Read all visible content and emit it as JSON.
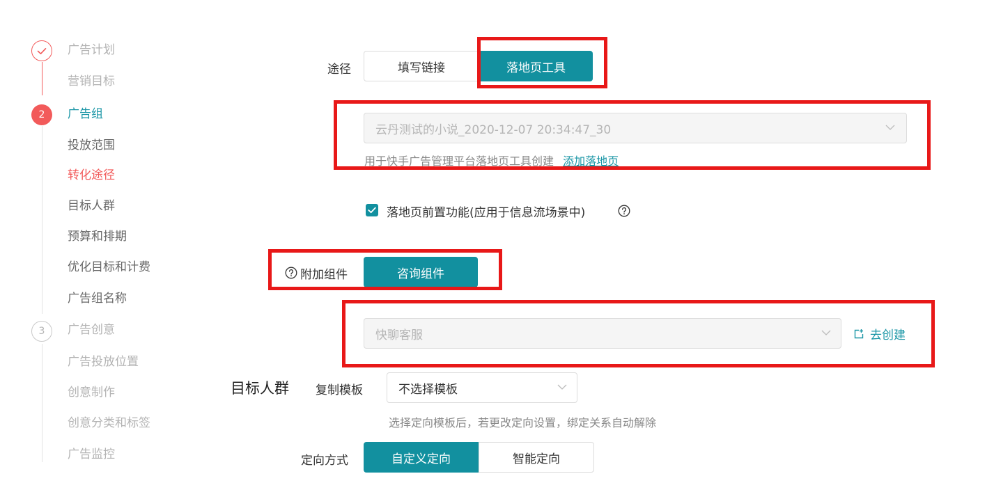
{
  "colors": {
    "accent": "#12909f",
    "link": "#1a96a6",
    "step_active": "#f25a5a",
    "annotation_red": "#e81818"
  },
  "steps": [
    {
      "number": "",
      "label": "广告计划",
      "state": "done",
      "icon": "check-icon",
      "items": [
        {
          "label": "营销目标"
        }
      ]
    },
    {
      "number": "2",
      "label": "广告组",
      "state": "current",
      "items": [
        {
          "label": "投放范围"
        },
        {
          "label": "转化途径",
          "current": true
        },
        {
          "label": "目标人群"
        },
        {
          "label": "预算和排期"
        },
        {
          "label": "优化目标和计费"
        },
        {
          "label": "广告组名称"
        }
      ]
    },
    {
      "number": "3",
      "label": "广告创意",
      "state": "todo",
      "items": [
        {
          "label": "广告投放位置"
        },
        {
          "label": "创意制作"
        },
        {
          "label": "创意分类和标签"
        },
        {
          "label": "广告监控"
        }
      ]
    }
  ],
  "conversion": {
    "path_label": "途径",
    "path_options": [
      "填写链接",
      "落地页工具"
    ],
    "path_selected": "落地页工具",
    "landing_select_value": "云丹测试的小说_2020-12-07 20:34:47_30",
    "landing_hint": "用于快手广告管理平台落地页工具创建",
    "add_landing_link": "添加落地页",
    "prefix_checkbox_label": "落地页前置功能(应用于信息流场景中)",
    "prefix_checked": true,
    "addon_label": "附加组件",
    "addon_option": "咨询组件",
    "component_select_value": "快聊客服",
    "create_link": "去创建"
  },
  "audience": {
    "section_title": "目标人群",
    "copy_template_label": "复制模板",
    "template_select_value": "不选择模板",
    "template_hint": "选择定向模板后，若更改定向设置，绑定关系自动解除",
    "targeting_label": "定向方式",
    "targeting_options": [
      "自定义定向",
      "智能定向"
    ],
    "targeting_selected": "自定义定向"
  }
}
